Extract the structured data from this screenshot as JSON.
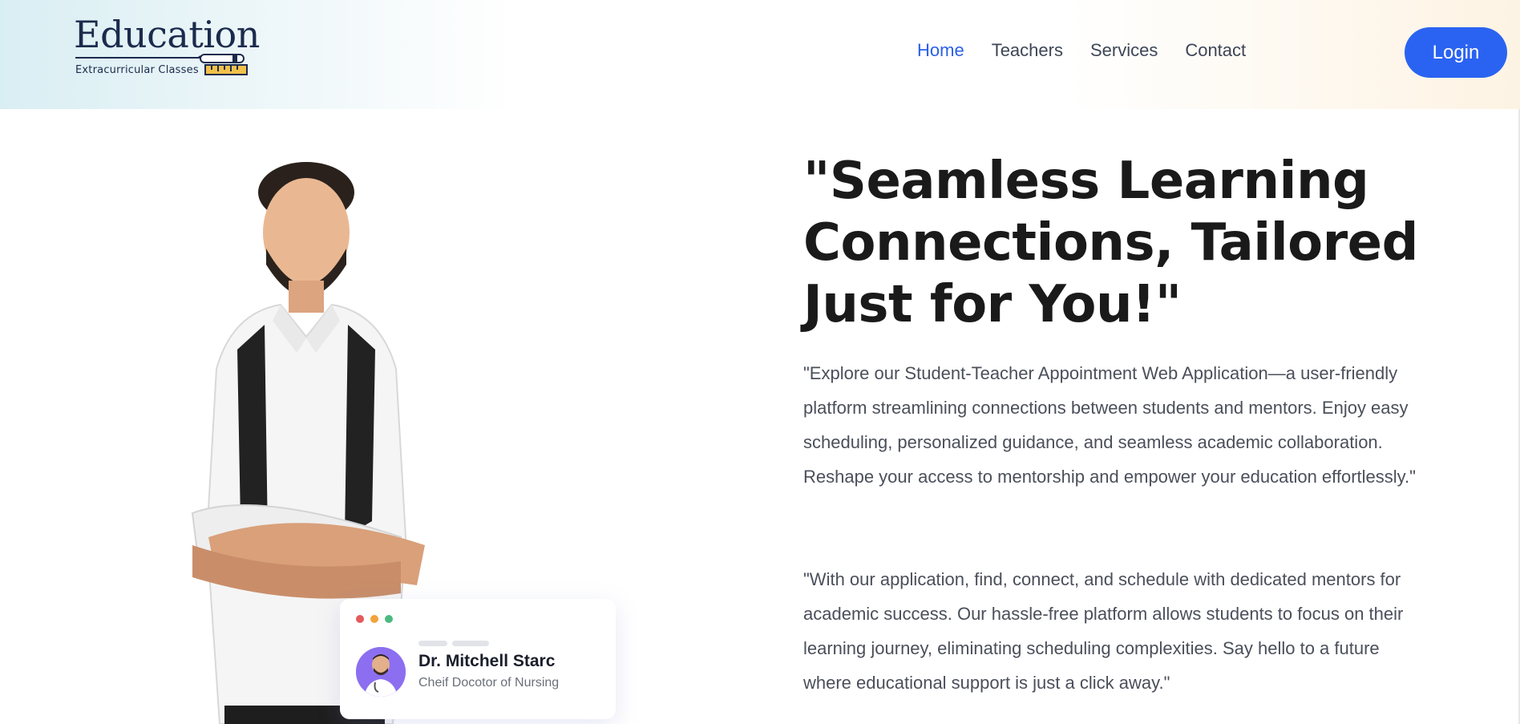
{
  "brand": {
    "title": "Education",
    "subtitle": "Extracurricular Classes"
  },
  "nav": {
    "items": [
      {
        "label": "Home",
        "active": true
      },
      {
        "label": "Teachers",
        "active": false
      },
      {
        "label": "Services",
        "active": false
      },
      {
        "label": "Contact",
        "active": false
      }
    ],
    "login_label": "Login"
  },
  "hero": {
    "headline": "\"Seamless Learning Connections, Tailored Just for You!\"",
    "paragraph_1": "\"Explore our Student-Teacher Appointment Web Application—a user-friendly platform streamlining connections between students and mentors. Enjoy easy scheduling, personalized guidance, and seamless academic collaboration. Reshape your access to mentorship and empower your education effortlessly.\"",
    "paragraph_2": "\"With our application, find, connect, and schedule with dedicated mentors for academic success. Our hassle-free platform allows students to focus on their learning journey, eliminating scheduling complexities. Say hello to a future where educational support is just a click away.\""
  },
  "profile_card": {
    "name": "Dr. Mitchell Starc",
    "role": "Cheif Docotor of Nursing"
  },
  "colors": {
    "accent": "#2a63f2",
    "nav_active": "#2a5fe8",
    "dot_red": "#e55a5a",
    "dot_orange": "#f2a33a",
    "dot_green": "#4cba7f"
  }
}
